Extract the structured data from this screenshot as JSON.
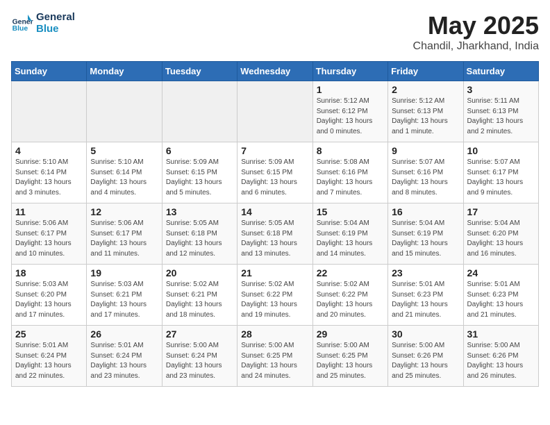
{
  "header": {
    "logo_line1": "General",
    "logo_line2": "Blue",
    "month": "May 2025",
    "location": "Chandil, Jharkhand, India"
  },
  "weekdays": [
    "Sunday",
    "Monday",
    "Tuesday",
    "Wednesday",
    "Thursday",
    "Friday",
    "Saturday"
  ],
  "weeks": [
    [
      {
        "day": "",
        "info": ""
      },
      {
        "day": "",
        "info": ""
      },
      {
        "day": "",
        "info": ""
      },
      {
        "day": "",
        "info": ""
      },
      {
        "day": "1",
        "info": "Sunrise: 5:12 AM\nSunset: 6:12 PM\nDaylight: 13 hours\nand 0 minutes."
      },
      {
        "day": "2",
        "info": "Sunrise: 5:12 AM\nSunset: 6:13 PM\nDaylight: 13 hours\nand 1 minute."
      },
      {
        "day": "3",
        "info": "Sunrise: 5:11 AM\nSunset: 6:13 PM\nDaylight: 13 hours\nand 2 minutes."
      }
    ],
    [
      {
        "day": "4",
        "info": "Sunrise: 5:10 AM\nSunset: 6:14 PM\nDaylight: 13 hours\nand 3 minutes."
      },
      {
        "day": "5",
        "info": "Sunrise: 5:10 AM\nSunset: 6:14 PM\nDaylight: 13 hours\nand 4 minutes."
      },
      {
        "day": "6",
        "info": "Sunrise: 5:09 AM\nSunset: 6:15 PM\nDaylight: 13 hours\nand 5 minutes."
      },
      {
        "day": "7",
        "info": "Sunrise: 5:09 AM\nSunset: 6:15 PM\nDaylight: 13 hours\nand 6 minutes."
      },
      {
        "day": "8",
        "info": "Sunrise: 5:08 AM\nSunset: 6:16 PM\nDaylight: 13 hours\nand 7 minutes."
      },
      {
        "day": "9",
        "info": "Sunrise: 5:07 AM\nSunset: 6:16 PM\nDaylight: 13 hours\nand 8 minutes."
      },
      {
        "day": "10",
        "info": "Sunrise: 5:07 AM\nSunset: 6:17 PM\nDaylight: 13 hours\nand 9 minutes."
      }
    ],
    [
      {
        "day": "11",
        "info": "Sunrise: 5:06 AM\nSunset: 6:17 PM\nDaylight: 13 hours\nand 10 minutes."
      },
      {
        "day": "12",
        "info": "Sunrise: 5:06 AM\nSunset: 6:17 PM\nDaylight: 13 hours\nand 11 minutes."
      },
      {
        "day": "13",
        "info": "Sunrise: 5:05 AM\nSunset: 6:18 PM\nDaylight: 13 hours\nand 12 minutes."
      },
      {
        "day": "14",
        "info": "Sunrise: 5:05 AM\nSunset: 6:18 PM\nDaylight: 13 hours\nand 13 minutes."
      },
      {
        "day": "15",
        "info": "Sunrise: 5:04 AM\nSunset: 6:19 PM\nDaylight: 13 hours\nand 14 minutes."
      },
      {
        "day": "16",
        "info": "Sunrise: 5:04 AM\nSunset: 6:19 PM\nDaylight: 13 hours\nand 15 minutes."
      },
      {
        "day": "17",
        "info": "Sunrise: 5:04 AM\nSunset: 6:20 PM\nDaylight: 13 hours\nand 16 minutes."
      }
    ],
    [
      {
        "day": "18",
        "info": "Sunrise: 5:03 AM\nSunset: 6:20 PM\nDaylight: 13 hours\nand 17 minutes."
      },
      {
        "day": "19",
        "info": "Sunrise: 5:03 AM\nSunset: 6:21 PM\nDaylight: 13 hours\nand 17 minutes."
      },
      {
        "day": "20",
        "info": "Sunrise: 5:02 AM\nSunset: 6:21 PM\nDaylight: 13 hours\nand 18 minutes."
      },
      {
        "day": "21",
        "info": "Sunrise: 5:02 AM\nSunset: 6:22 PM\nDaylight: 13 hours\nand 19 minutes."
      },
      {
        "day": "22",
        "info": "Sunrise: 5:02 AM\nSunset: 6:22 PM\nDaylight: 13 hours\nand 20 minutes."
      },
      {
        "day": "23",
        "info": "Sunrise: 5:01 AM\nSunset: 6:23 PM\nDaylight: 13 hours\nand 21 minutes."
      },
      {
        "day": "24",
        "info": "Sunrise: 5:01 AM\nSunset: 6:23 PM\nDaylight: 13 hours\nand 21 minutes."
      }
    ],
    [
      {
        "day": "25",
        "info": "Sunrise: 5:01 AM\nSunset: 6:24 PM\nDaylight: 13 hours\nand 22 minutes."
      },
      {
        "day": "26",
        "info": "Sunrise: 5:01 AM\nSunset: 6:24 PM\nDaylight: 13 hours\nand 23 minutes."
      },
      {
        "day": "27",
        "info": "Sunrise: 5:00 AM\nSunset: 6:24 PM\nDaylight: 13 hours\nand 23 minutes."
      },
      {
        "day": "28",
        "info": "Sunrise: 5:00 AM\nSunset: 6:25 PM\nDaylight: 13 hours\nand 24 minutes."
      },
      {
        "day": "29",
        "info": "Sunrise: 5:00 AM\nSunset: 6:25 PM\nDaylight: 13 hours\nand 25 minutes."
      },
      {
        "day": "30",
        "info": "Sunrise: 5:00 AM\nSunset: 6:26 PM\nDaylight: 13 hours\nand 25 minutes."
      },
      {
        "day": "31",
        "info": "Sunrise: 5:00 AM\nSunset: 6:26 PM\nDaylight: 13 hours\nand 26 minutes."
      }
    ]
  ]
}
